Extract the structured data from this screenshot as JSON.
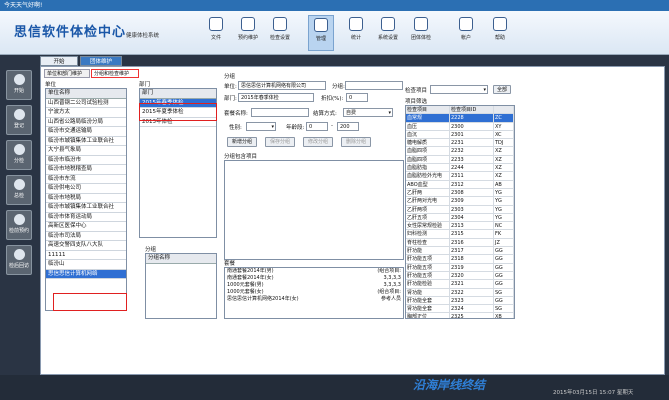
{
  "titlebar": {
    "text": "今天天气好啊!"
  },
  "header": {
    "brand": "思信软件体检中心",
    "subtitle": "健康体检系统"
  },
  "toolbar": [
    {
      "label": "文件",
      "icon": "file-icon"
    },
    {
      "label": "预约维护",
      "icon": "calendar-icon"
    },
    {
      "label": "检查设置",
      "icon": "settings-icon"
    },
    {
      "label": "管理",
      "icon": "dashboard-icon"
    },
    {
      "label": "统计",
      "icon": "chart-icon"
    },
    {
      "label": "系统设置",
      "icon": "gear-icon"
    },
    {
      "label": "团体体检",
      "icon": "group-icon"
    },
    {
      "label": "帐户",
      "icon": "user-icon"
    },
    {
      "label": "帮助",
      "icon": "help-icon"
    }
  ],
  "tabs": [
    {
      "label": "开始"
    },
    {
      "label": "团体维护"
    }
  ],
  "leftnav": [
    {
      "label": "开始"
    },
    {
      "label": "登记"
    },
    {
      "label": "分检"
    },
    {
      "label": "总检"
    },
    {
      "label": "检前预约"
    },
    {
      "label": "检后回访"
    }
  ],
  "subtabs": [
    {
      "label": "单位和部门维护"
    },
    {
      "label": "分组和检查维护"
    }
  ],
  "unit": {
    "label": "单位",
    "header": "单位名称",
    "items": [
      "山西晋钢二公司试验检测",
      "宁波方太",
      "山西省公路局临汾分局",
      "临汾市交通运输局",
      "临汾市城镇集体工业联合社",
      "大宁县气象局",
      "临汾市临汾市",
      "临汾市地税稽查局",
      "临汾市东流",
      "临汾供电公司",
      "临汾市地税局",
      "临汾市城镇集体工业联合社",
      "临汾市体育运动局",
      "高新区医保中心",
      "临汾市司法局",
      "高速交警四支队八大队",
      "11111",
      "临汾山",
      "思信思信计算机网络"
    ]
  },
  "dept": {
    "label": "部门",
    "header": "部门",
    "items": [
      "2015年春季体检",
      "2015年夏季体检",
      "2013年体检"
    ],
    "selected": "2015年春季体检"
  },
  "group_list": {
    "label": "分组",
    "header": "分组名称"
  },
  "group_form": {
    "label": "分组",
    "unit_label": "单位:",
    "unit_value": "思信思信计算机网络有限公司",
    "group_label": "分组:",
    "dept_label": "部门:",
    "dept_value": "2015年春季体检",
    "discount_label": "折扣(%):",
    "discount_value": "0",
    "package_label": "套餐名称:",
    "settle_label": "结算方式:",
    "settle_value": "自费",
    "gender_label": "性别:",
    "age_label": "年龄段:",
    "age_from": "0",
    "age_sep": "-",
    "age_to": "200",
    "buttons": {
      "add": "新增分组",
      "save": "保存分组",
      "edit": "修改分组",
      "delete": "删除分组"
    },
    "items_label": "分组包含项目",
    "package_section_label": "套餐",
    "packages": [
      {
        "name": "南通套餐2014年(男)",
        "note": "(组合项目:"
      },
      {
        "name": "南通套餐2014年(女)",
        "note": "3,3,3,3"
      },
      {
        "name": "1000元套餐(男)",
        "note": "3,3,3,3"
      },
      {
        "name": "1000元套餐(女)",
        "note": "(组合项目:"
      },
      {
        "name": "思信思信计算机网络2014年(女)",
        "note": "参考人员"
      }
    ]
  },
  "check_items": {
    "label": "检查项目",
    "confirm_button": "全部",
    "filter_label": "项目筛选",
    "headers": [
      "检查项目",
      "检查项目ID",
      ""
    ],
    "rows": [
      {
        "name": "血常规",
        "id": "2228",
        "code": "ZC"
      },
      {
        "name": "血压",
        "id": "2300",
        "code": "XY"
      },
      {
        "name": "血沉",
        "id": "2301",
        "code": "XC"
      },
      {
        "name": "糖电解质",
        "id": "2231",
        "code": "TDJ"
      },
      {
        "name": "血脂四项",
        "id": "2232",
        "code": "XZ"
      },
      {
        "name": "血脂四项",
        "id": "2233",
        "code": "XZ"
      },
      {
        "name": "血脂肪指",
        "id": "2244",
        "code": "XZ"
      },
      {
        "name": "血脂肪检外光电",
        "id": "2311",
        "code": "XZ"
      },
      {
        "name": "ABO血型",
        "id": "2312",
        "code": "AB"
      },
      {
        "name": "乙肝两",
        "id": "2308",
        "code": "YG"
      },
      {
        "name": "乙肝两对光电",
        "id": "2309",
        "code": "YG"
      },
      {
        "name": "乙肝两项",
        "id": "2303",
        "code": "YG"
      },
      {
        "name": "乙肝五项",
        "id": "2304",
        "code": "YG"
      },
      {
        "name": "女性尿常规检验",
        "id": "2313",
        "code": "NC"
      },
      {
        "name": "妇科检测",
        "id": "2315",
        "code": "FK"
      },
      {
        "name": "脊柱检查",
        "id": "2316",
        "code": "JZ"
      },
      {
        "name": "肝功能",
        "id": "2317",
        "code": "GG"
      },
      {
        "name": "肝功能五项",
        "id": "2318",
        "code": "GG"
      },
      {
        "name": "肝功能五项",
        "id": "2319",
        "code": "GG"
      },
      {
        "name": "肝功能五项",
        "id": "2320",
        "code": "GG"
      },
      {
        "name": "肝功能检验",
        "id": "2321",
        "code": "GG"
      },
      {
        "name": "肾功能",
        "id": "2322",
        "code": "SG"
      },
      {
        "name": "肝功能全套",
        "id": "2323",
        "code": "GG"
      },
      {
        "name": "肾功能全套",
        "id": "2324",
        "code": "SG"
      },
      {
        "name": "胸部正位",
        "id": "2325",
        "code": "XB"
      }
    ]
  },
  "footer": {
    "overlay_text": "沿海岸线终结",
    "datetime": "2015年03月15日 15:07 星期天"
  }
}
